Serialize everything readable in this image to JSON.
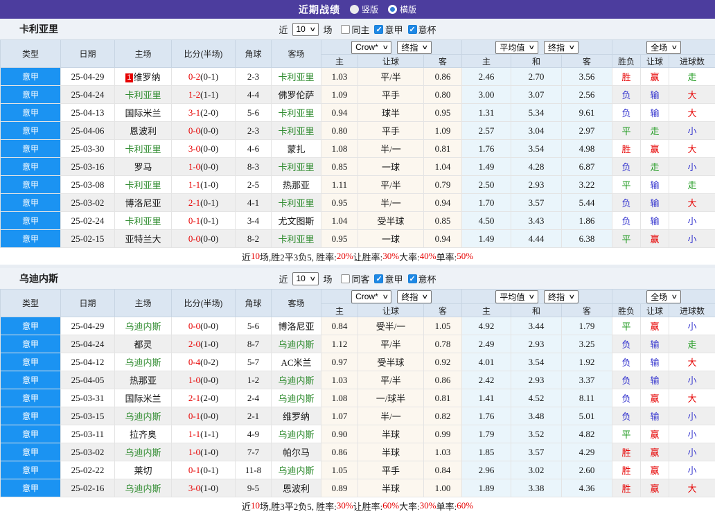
{
  "topbar": {
    "title": "近期战绩",
    "options": [
      {
        "label": "竖版",
        "selected": false
      },
      {
        "label": "横版",
        "selected": true
      }
    ]
  },
  "selects": {
    "crow": "Crow*",
    "final": "终指",
    "avg": "平均值",
    "full": "全场"
  },
  "table_header": {
    "col_type": "类型",
    "col_date": "日期",
    "col_home": "主场",
    "col_score": "比分(半场)",
    "col_corner": "角球",
    "col_away": "客场",
    "sub_home": "主",
    "sub_handicap": "让球",
    "sub_away": "客",
    "sub_avg_home": "主",
    "sub_draw": "和",
    "sub_avg_away": "客",
    "sub_result": "胜负",
    "sub_handicap_result": "让球",
    "sub_goals": "进球数"
  },
  "colors": {
    "accent_purple": "#4c3d9e",
    "league_blue": "#1b93f2",
    "win_red": "#e60000",
    "lose_blue": "#3737cf",
    "draw_green": "#1f9a1f",
    "team_green": "#2e8b2e"
  },
  "sections": [
    {
      "team": "卡利亚里",
      "controls": {
        "near": "近",
        "count": "10",
        "games": "场",
        "checkboxes": [
          {
            "label": "同主",
            "checked": false
          },
          {
            "label": "意甲",
            "checked": true
          },
          {
            "label": "意杯",
            "checked": true
          }
        ]
      },
      "rows": [
        {
          "league": "意甲",
          "date": "25-04-29",
          "home": "维罗纳",
          "home_badge": "1",
          "score": "0-2",
          "half": "(0-1)",
          "corner": "2-3",
          "away": "卡利亚里",
          "odds_home": "1.03",
          "handicap": "平/半",
          "odds_away": "0.86",
          "avg_home": "2.46",
          "avg_draw": "2.70",
          "avg_away": "3.56",
          "result": "胜",
          "handicap_result": "赢",
          "goals": "走"
        },
        {
          "league": "意甲",
          "date": "25-04-24",
          "home": "卡利亚里",
          "score": "1-2",
          "half": "(1-1)",
          "corner": "4-4",
          "away": "佛罗伦萨",
          "odds_home": "1.09",
          "handicap": "平手",
          "odds_away": "0.80",
          "avg_home": "3.00",
          "avg_draw": "3.07",
          "avg_away": "2.56",
          "result": "负",
          "handicap_result": "输",
          "goals": "大"
        },
        {
          "league": "意甲",
          "date": "25-04-13",
          "home": "国际米兰",
          "score": "3-1",
          "half": "(2-0)",
          "corner": "5-6",
          "away": "卡利亚里",
          "odds_home": "0.94",
          "handicap": "球半",
          "odds_away": "0.95",
          "avg_home": "1.31",
          "avg_draw": "5.34",
          "avg_away": "9.61",
          "result": "负",
          "handicap_result": "输",
          "goals": "大"
        },
        {
          "league": "意甲",
          "date": "25-04-06",
          "home": "恩波利",
          "score": "0-0",
          "half": "(0-0)",
          "corner": "2-3",
          "away": "卡利亚里",
          "odds_home": "0.80",
          "handicap": "平手",
          "odds_away": "1.09",
          "avg_home": "2.57",
          "avg_draw": "3.04",
          "avg_away": "2.97",
          "result": "平",
          "handicap_result": "走",
          "goals": "小"
        },
        {
          "league": "意甲",
          "date": "25-03-30",
          "home": "卡利亚里",
          "score": "3-0",
          "half": "(0-0)",
          "corner": "4-6",
          "away": "蒙扎",
          "odds_home": "1.08",
          "handicap": "半/一",
          "odds_away": "0.81",
          "avg_home": "1.76",
          "avg_draw": "3.54",
          "avg_away": "4.98",
          "result": "胜",
          "handicap_result": "赢",
          "goals": "大"
        },
        {
          "league": "意甲",
          "date": "25-03-16",
          "home": "罗马",
          "score": "1-0",
          "half": "(0-0)",
          "corner": "8-3",
          "away": "卡利亚里",
          "odds_home": "0.85",
          "handicap": "一球",
          "odds_away": "1.04",
          "avg_home": "1.49",
          "avg_draw": "4.28",
          "avg_away": "6.87",
          "result": "负",
          "handicap_result": "走",
          "goals": "小"
        },
        {
          "league": "意甲",
          "date": "25-03-08",
          "home": "卡利亚里",
          "score": "1-1",
          "half": "(1-0)",
          "corner": "2-5",
          "away": "热那亚",
          "odds_home": "1.11",
          "handicap": "平/半",
          "odds_away": "0.79",
          "avg_home": "2.50",
          "avg_draw": "2.93",
          "avg_away": "3.22",
          "result": "平",
          "handicap_result": "输",
          "goals": "走"
        },
        {
          "league": "意甲",
          "date": "25-03-02",
          "home": "博洛尼亚",
          "score": "2-1",
          "half": "(0-1)",
          "corner": "4-1",
          "away": "卡利亚里",
          "odds_home": "0.95",
          "handicap": "半/一",
          "odds_away": "0.94",
          "avg_home": "1.70",
          "avg_draw": "3.57",
          "avg_away": "5.44",
          "result": "负",
          "handicap_result": "输",
          "goals": "大"
        },
        {
          "league": "意甲",
          "date": "25-02-24",
          "home": "卡利亚里",
          "score": "0-1",
          "half": "(0-1)",
          "corner": "3-4",
          "away": "尤文图斯",
          "odds_home": "1.04",
          "handicap": "受半球",
          "odds_away": "0.85",
          "avg_home": "4.50",
          "avg_draw": "3.43",
          "avg_away": "1.86",
          "result": "负",
          "handicap_result": "输",
          "goals": "小"
        },
        {
          "league": "意甲",
          "date": "25-02-15",
          "home": "亚特兰大",
          "score": "0-0",
          "half": "(0-0)",
          "corner": "8-2",
          "away": "卡利亚里",
          "odds_home": "0.95",
          "handicap": "一球",
          "odds_away": "0.94",
          "avg_home": "1.49",
          "avg_draw": "4.44",
          "avg_away": "6.38",
          "result": "平",
          "handicap_result": "赢",
          "goals": "小"
        }
      ],
      "summary": [
        {
          "text": "近",
          "red": false
        },
        {
          "text": "10",
          "red": true
        },
        {
          "text": "场,胜2平3负5, 胜率:",
          "red": false
        },
        {
          "text": "20%",
          "red": true
        },
        {
          "text": " 让胜率:",
          "red": false
        },
        {
          "text": "30%",
          "red": true
        },
        {
          "text": " 大率:",
          "red": false
        },
        {
          "text": "40%",
          "red": true
        },
        {
          "text": " 单率:",
          "red": false
        },
        {
          "text": "50%",
          "red": true
        }
      ]
    },
    {
      "team": "乌迪内斯",
      "controls": {
        "near": "近",
        "count": "10",
        "games": "场",
        "checkboxes": [
          {
            "label": "同客",
            "checked": false
          },
          {
            "label": "意甲",
            "checked": true
          },
          {
            "label": "意杯",
            "checked": true
          }
        ]
      },
      "rows": [
        {
          "league": "意甲",
          "date": "25-04-29",
          "home": "乌迪内斯",
          "score": "0-0",
          "half": "(0-0)",
          "corner": "5-6",
          "away": "博洛尼亚",
          "odds_home": "0.84",
          "handicap": "受半/一",
          "odds_away": "1.05",
          "avg_home": "4.92",
          "avg_draw": "3.44",
          "avg_away": "1.79",
          "result": "平",
          "handicap_result": "赢",
          "goals": "小"
        },
        {
          "league": "意甲",
          "date": "25-04-24",
          "home": "都灵",
          "score": "2-0",
          "half": "(1-0)",
          "corner": "8-7",
          "away": "乌迪内斯",
          "odds_home": "1.12",
          "handicap": "平/半",
          "odds_away": "0.78",
          "avg_home": "2.49",
          "avg_draw": "2.93",
          "avg_away": "3.25",
          "result": "负",
          "handicap_result": "输",
          "goals": "走"
        },
        {
          "league": "意甲",
          "date": "25-04-12",
          "home": "乌迪内斯",
          "score": "0-4",
          "half": "(0-2)",
          "corner": "5-7",
          "away": "AC米兰",
          "odds_home": "0.97",
          "handicap": "受半球",
          "odds_away": "0.92",
          "avg_home": "4.01",
          "avg_draw": "3.54",
          "avg_away": "1.92",
          "result": "负",
          "handicap_result": "输",
          "goals": "大"
        },
        {
          "league": "意甲",
          "date": "25-04-05",
          "home": "热那亚",
          "score": "1-0",
          "half": "(0-0)",
          "corner": "1-2",
          "away": "乌迪内斯",
          "odds_home": "1.03",
          "handicap": "平/半",
          "odds_away": "0.86",
          "avg_home": "2.42",
          "avg_draw": "2.93",
          "avg_away": "3.37",
          "result": "负",
          "handicap_result": "输",
          "goals": "小"
        },
        {
          "league": "意甲",
          "date": "25-03-31",
          "home": "国际米兰",
          "score": "2-1",
          "half": "(2-0)",
          "corner": "2-4",
          "away": "乌迪内斯",
          "odds_home": "1.08",
          "handicap": "一/球半",
          "odds_away": "0.81",
          "avg_home": "1.41",
          "avg_draw": "4.52",
          "avg_away": "8.11",
          "result": "负",
          "handicap_result": "赢",
          "goals": "大"
        },
        {
          "league": "意甲",
          "date": "25-03-15",
          "home": "乌迪内斯",
          "score": "0-1",
          "half": "(0-0)",
          "corner": "2-1",
          "away": "维罗纳",
          "odds_home": "1.07",
          "handicap": "半/一",
          "odds_away": "0.82",
          "avg_home": "1.76",
          "avg_draw": "3.48",
          "avg_away": "5.01",
          "result": "负",
          "handicap_result": "输",
          "goals": "小"
        },
        {
          "league": "意甲",
          "date": "25-03-11",
          "home": "拉齐奥",
          "score": "1-1",
          "half": "(1-1)",
          "corner": "4-9",
          "away": "乌迪内斯",
          "odds_home": "0.90",
          "handicap": "半球",
          "odds_away": "0.99",
          "avg_home": "1.79",
          "avg_draw": "3.52",
          "avg_away": "4.82",
          "result": "平",
          "handicap_result": "赢",
          "goals": "小"
        },
        {
          "league": "意甲",
          "date": "25-03-02",
          "home": "乌迪内斯",
          "score": "1-0",
          "half": "(1-0)",
          "corner": "7-7",
          "away": "帕尔马",
          "odds_home": "0.86",
          "handicap": "半球",
          "odds_away": "1.03",
          "avg_home": "1.85",
          "avg_draw": "3.57",
          "avg_away": "4.29",
          "result": "胜",
          "handicap_result": "赢",
          "goals": "小"
        },
        {
          "league": "意甲",
          "date": "25-02-22",
          "home": "莱切",
          "score": "0-1",
          "half": "(0-1)",
          "corner": "11-8",
          "away": "乌迪内斯",
          "odds_home": "1.05",
          "handicap": "平手",
          "odds_away": "0.84",
          "avg_home": "2.96",
          "avg_draw": "3.02",
          "avg_away": "2.60",
          "result": "胜",
          "handicap_result": "赢",
          "goals": "小"
        },
        {
          "league": "意甲",
          "date": "25-02-16",
          "home": "乌迪内斯",
          "score": "3-0",
          "half": "(1-0)",
          "corner": "9-5",
          "away": "恩波利",
          "odds_home": "0.89",
          "handicap": "半球",
          "odds_away": "1.00",
          "avg_home": "1.89",
          "avg_draw": "3.38",
          "avg_away": "4.36",
          "result": "胜",
          "handicap_result": "赢",
          "goals": "大"
        }
      ],
      "summary": [
        {
          "text": "近",
          "red": false
        },
        {
          "text": "10",
          "red": true
        },
        {
          "text": "场,胜3平2负5, 胜率:",
          "red": false
        },
        {
          "text": "30%",
          "red": true
        },
        {
          "text": " 让胜率:",
          "red": false
        },
        {
          "text": "60%",
          "red": true
        },
        {
          "text": " 大率:",
          "red": false
        },
        {
          "text": "30%",
          "red": true
        },
        {
          "text": " 单率:",
          "red": false
        },
        {
          "text": "60%",
          "red": true
        }
      ]
    }
  ]
}
